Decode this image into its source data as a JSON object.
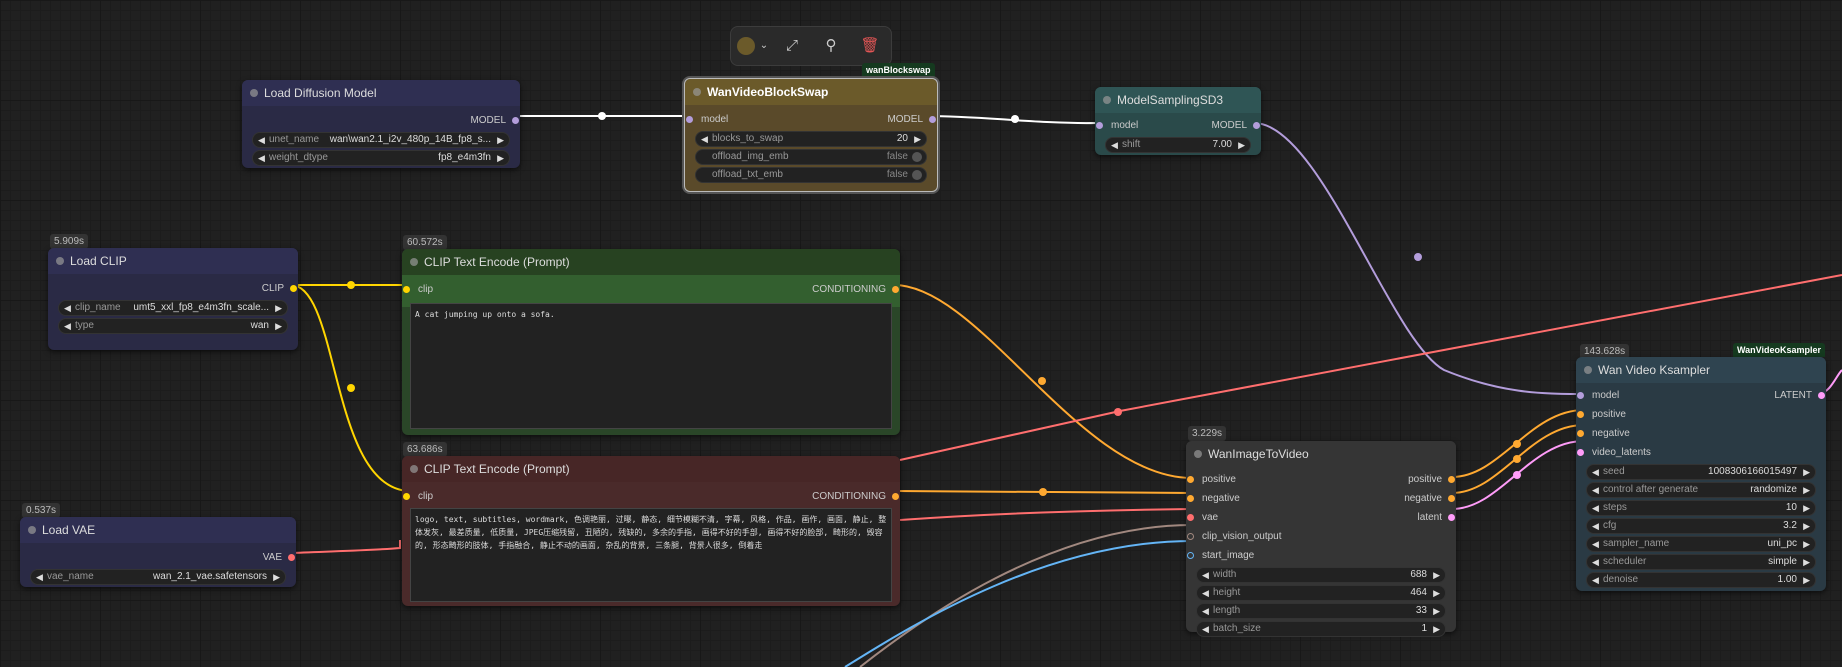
{
  "toolbar": {
    "color_swatch": "#6b5a2a",
    "items": [
      {
        "icon": "color-picker-icon",
        "glyph": "⌄"
      },
      {
        "icon": "bypass-icon",
        "glyph": "⤢"
      },
      {
        "icon": "pin-icon",
        "glyph": "⚲"
      },
      {
        "icon": "trash-icon",
        "glyph": "🗑"
      }
    ]
  },
  "nodes": {
    "load_diffusion": {
      "title": "Load Diffusion Model",
      "output": "MODEL",
      "unet_name_label": "unet_name",
      "unet_name_value": "wan\\wan2.1_i2v_480p_14B_fp8_s...",
      "weight_dtype_label": "weight_dtype",
      "weight_dtype_value": "fp8_e4m3fn"
    },
    "blockswap": {
      "title": "WanVideoBlockSwap",
      "tag": "wanBlockswap",
      "input": "model",
      "output": "MODEL",
      "blocks_label": "blocks_to_swap",
      "blocks_value": "20",
      "offload_img_label": "offload_img_emb",
      "offload_img_value": "false",
      "offload_txt_label": "offload_txt_emb",
      "offload_txt_value": "false"
    },
    "sampling_sd3": {
      "title": "ModelSamplingSD3",
      "input": "model",
      "output": "MODEL",
      "shift_label": "shift",
      "shift_value": "7.00"
    },
    "load_clip": {
      "time": "5.909s",
      "title": "Load CLIP",
      "output": "CLIP",
      "clip_name_label": "clip_name",
      "clip_name_value": "umt5_xxl_fp8_e4m3fn_scale...",
      "type_label": "type",
      "type_value": "wan"
    },
    "clip_pos": {
      "time": "60.572s",
      "title": "CLIP Text Encode (Prompt)",
      "input": "clip",
      "output": "CONDITIONING",
      "text": "A cat jumping up onto a sofa."
    },
    "clip_neg": {
      "time": "63.686s",
      "title": "CLIP Text Encode (Prompt)",
      "input": "clip",
      "output": "CONDITIONING",
      "text": "logo, text, subtitles, wordmark, 色调艳丽, 过曝, 静态, 细节模糊不清, 字幕, 风格, 作品, 画作, 画面, 静止, 整体发灰, 最差质量, 低质量, JPEG压缩残留, 丑陋的, 残缺的, 多余的手指, 画得不好的手部, 画得不好的脸部, 畸形的, 毁容的, 形态畸形的肢体, 手指融合, 静止不动的画面, 杂乱的背景, 三条腿, 背景人很多, 倒着走"
    },
    "load_vae": {
      "time": "0.537s",
      "title": "Load VAE",
      "output": "VAE",
      "vae_name_label": "vae_name",
      "vae_name_value": "wan_2.1_vae.safetensors"
    },
    "img2video": {
      "time": "3.229s",
      "title": "WanImageToVideo",
      "inputs": [
        "positive",
        "negative",
        "vae",
        "clip_vision_output",
        "start_image"
      ],
      "outputs": [
        "positive",
        "negative",
        "latent"
      ],
      "width_label": "width",
      "width_value": "688",
      "height_label": "height",
      "height_value": "464",
      "length_label": "length",
      "length_value": "33",
      "batch_label": "batch_size",
      "batch_value": "1"
    },
    "ksampler": {
      "time": "143.628s",
      "tag": "WanVideoKsampler",
      "title": "Wan Video Ksampler",
      "inputs": [
        "model",
        "positive",
        "negative",
        "video_latents"
      ],
      "output": "LATENT",
      "seed_label": "seed",
      "seed_value": "1008306166015497",
      "control_label": "control after generate",
      "control_value": "randomize",
      "steps_label": "steps",
      "steps_value": "10",
      "cfg_label": "cfg",
      "cfg_value": "3.2",
      "sampler_label": "sampler_name",
      "sampler_value": "uni_pc",
      "scheduler_label": "scheduler",
      "scheduler_value": "simple",
      "denoise_label": "denoise",
      "denoise_value": "1.00"
    }
  },
  "colors": {
    "model": "#b39ddb",
    "clip": "#ffd500",
    "conditioning": "#ffa931",
    "vae": "#ff6e6e",
    "latent": "#ff9cf9",
    "image": "#64b5f6",
    "clip_vision": "#a1887f"
  }
}
